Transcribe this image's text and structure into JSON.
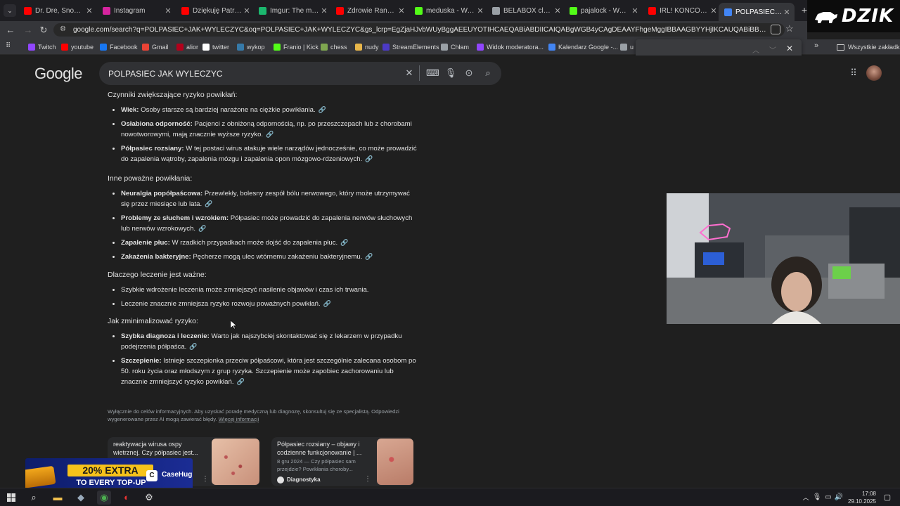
{
  "browser": {
    "tabs": [
      {
        "label": "Dr. Dre, Snoop Do",
        "icon": "youtube-icon",
        "color": "#ff0000"
      },
      {
        "label": "Instagram",
        "icon": "instagram-icon",
        "color": "#d6249f"
      },
      {
        "label": "Dziękuję Patryk, j",
        "icon": "youtube-icon",
        "color": "#ff0000"
      },
      {
        "label": "Imgur: The magic",
        "icon": "imgur-icon",
        "color": "#1bb76e"
      },
      {
        "label": "Zdrowie Rano. Pó",
        "icon": "youtube-icon",
        "color": "#ff0000"
      },
      {
        "label": "meduska - Watch",
        "icon": "kick-icon",
        "color": "#53fc18"
      },
      {
        "label": "BELABOX cloud",
        "icon": "globe-icon",
        "color": "#9aa0a6"
      },
      {
        "label": "pajalock - Watch",
        "icon": "kick-icon",
        "color": "#53fc18"
      },
      {
        "label": "IRL! KOŃCÓWKA",
        "icon": "youtube-icon",
        "color": "#ff0000"
      },
      {
        "label": "POLPASIEC JAK W",
        "icon": "google-icon",
        "color": "#4285f4"
      }
    ],
    "url": "google.com/search?q=POLPASIEC+JAK+WYLECZYC&oq=POLPASIEC+JAK+WYLECZYC&gs_lcrp=EgZjaHJvbWUyBggAEEUYOTIHCAEQABiABDIICAIQABgWGB4yCAgDEAAYFhgeMggIBBAAGBYYHjIKCAUQABiBBBiJBTIHCAYQABjvBTIKCAcQABi..",
    "bookmarks": [
      {
        "label": "Twitch",
        "color": "#9146ff"
      },
      {
        "label": "youtube",
        "color": "#ff0000"
      },
      {
        "label": "Facebook",
        "color": "#1877f2"
      },
      {
        "label": "Gmail",
        "color": "#ea4335"
      },
      {
        "label": "alior",
        "color": "#b3001b"
      },
      {
        "label": "twitter",
        "color": "#ffffff"
      },
      {
        "label": "wykop",
        "color": "#367aa9"
      },
      {
        "label": "Franio | Kick",
        "color": "#53fc18"
      },
      {
        "label": "chess",
        "color": "#7fa650"
      },
      {
        "label": "nudy",
        "color": "#e8b64a"
      },
      {
        "label": "StreamElements",
        "color": "#4c3ac6"
      },
      {
        "label": "Chłam",
        "color": "#9aa0a6"
      },
      {
        "label": "Widok moderatora...",
        "color": "#9146ff"
      },
      {
        "label": "Kalendarz Google -...",
        "color": "#4285f4"
      },
      {
        "label": "u",
        "color": "#9aa0a6"
      }
    ],
    "bookmarks_folder": "Wszystkie zakładki",
    "stream_logo": "DZIK"
  },
  "google": {
    "logo": "Google",
    "query": "POLPASIEC JAK WYLECZYC"
  },
  "ai_overview": {
    "sections": [
      {
        "heading": "Czynniki zwiększające ryzyko powikłań:",
        "items": [
          {
            "bold": "Wiek:",
            "text": " Osoby starsze są bardziej narażone na ciężkie powikłania."
          },
          {
            "bold": "Osłabiona odporność:",
            "text": " Pacjenci z obniżoną odpornością, np. po przeszczepach lub z chorobami nowotworowymi, mają znacznie wyższe ryzyko."
          },
          {
            "bold": "Półpasiec rozsiany:",
            "text": " W tej postaci wirus atakuje wiele narządów jednocześnie, co może prowadzić do zapalenia wątroby, zapalenia mózgu i zapalenia opon mózgowo-rdzeniowych."
          }
        ]
      },
      {
        "heading": "Inne poważne powikłania:",
        "items": [
          {
            "bold": "Neuralgia popółpaścowa:",
            "text": " Przewlekły, bolesny zespół bólu nerwowego, który może utrzymywać się przez miesiące lub lata."
          },
          {
            "bold": "Problemy ze słuchem i wzrokiem:",
            "text": " Półpasiec może prowadzić do zapalenia nerwów słuchowych lub nerwów wzrokowych."
          },
          {
            "bold": "Zapalenie płuc:",
            "text": " W rzadkich przypadkach może dojść do zapalenia płuc."
          },
          {
            "bold": "Zakażenia bakteryjne:",
            "text": " Pęcherze mogą ulec wtórnemu zakażeniu bakteryjnemu."
          }
        ]
      },
      {
        "heading": "Dlaczego leczenie jest ważne:",
        "items": [
          {
            "bold": "",
            "text": "Szybkie wdrożenie leczenia może zmniejszyć nasilenie objawów i czas ich trwania."
          },
          {
            "bold": "",
            "text": "Leczenie znacznie zmniejsza ryzyko rozwoju poważnych powikłań."
          }
        ]
      },
      {
        "heading": "Jak zminimalizować ryzyko:",
        "items": [
          {
            "bold": "Szybka diagnoza i leczenie:",
            "text": " Warto jak najszybciej skontaktować się z lekarzem w przypadku podejrzenia półpaśca."
          },
          {
            "bold": "Szczepienie:",
            "text": " Istnieje szczepionka przeciw półpaścowi, która jest szczególnie zalecana osobom po 50. roku życia oraz młodszym z grup ryzyka. Szczepienie może zapobiec zachorowaniu lub znacznie zmniejszyć ryzyko powikłań."
          }
        ]
      }
    ],
    "disclaimer": "Wyłącznie do celów informacyjnych. Aby uzyskać poradę medyczną lub diagnozę, skonsultuj się ze specjalistą. Odpowiedzi wygenerowane przez AI mogą zawierać błędy.",
    "disclaimer_link": "Więcej informacji"
  },
  "cards": [
    {
      "title": "reaktywacja wirusa ospy wietrznej. Czy półpasiec jest...",
      "snippet": "",
      "source": ""
    },
    {
      "title": "Półpasiec rozsiany – objawy i codzienne funkcjonowanie | ...",
      "snippet": "8 gru 2024 — Czy półpasiec sam przejdzie? Powikłania choroby...",
      "source": "Diagnostyka"
    }
  ],
  "ad": {
    "headline": "20% EXTRA",
    "subline": "TO EVERY TOP-UP",
    "brand": "CaseHug"
  },
  "taskbar": {
    "time": "17:08",
    "date": "29.10.2025"
  }
}
